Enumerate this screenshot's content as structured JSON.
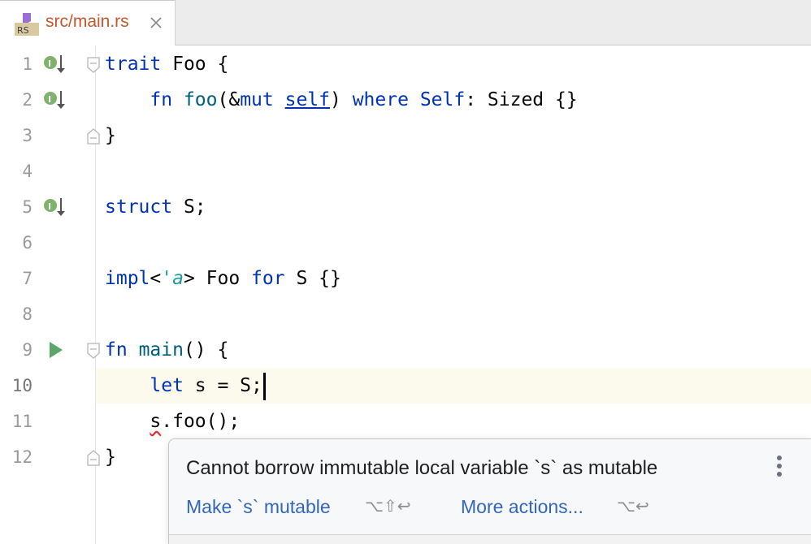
{
  "tab": {
    "label": "src/main.rs",
    "icon": "rust-file-icon",
    "icon_text": "RS"
  },
  "gutter": {
    "line_numbers": [
      "1",
      "2",
      "3",
      "4",
      "5",
      "6",
      "7",
      "8",
      "9",
      "10",
      "11",
      "12"
    ],
    "current_line": "10"
  },
  "code": {
    "l1": {
      "kw": "trait",
      "rest": " Foo {"
    },
    "l2": {
      "indent": "    ",
      "kw1": "fn",
      "sp1": " ",
      "name": "foo",
      "p1": "(&",
      "kw2": "mut",
      "sp2": " ",
      "self": "self",
      "p2": ") ",
      "kw3": "where",
      "sp3": " ",
      "kw4": "Self",
      "rest": ": Sized {}"
    },
    "l3": {
      "text": "}"
    },
    "l5": {
      "kw": "struct",
      "rest": " S;"
    },
    "l7": {
      "kw1": "impl",
      "p1": "<",
      "lt": "'a",
      "p2": "> Foo ",
      "kw2": "for",
      "rest": " S {}"
    },
    "l9": {
      "kw": "fn",
      "sp": " ",
      "name": "main",
      "rest": "() {"
    },
    "l10": {
      "indent": "    ",
      "kw": "let",
      "rest": " s = S;"
    },
    "l11": {
      "indent": "    ",
      "err": "s",
      "rest": ".foo();"
    },
    "l12": {
      "text": "}"
    }
  },
  "popup": {
    "message": "Cannot borrow immutable local variable `s` as mutable",
    "primary_action": "Make `s` mutable",
    "primary_shortcut": "⌥⇧↩",
    "more_actions": "More actions...",
    "more_shortcut": "⌥↩"
  },
  "colors": {
    "keyword": "#0033b3",
    "function": "#00627a",
    "lifetime": "#20999d",
    "link": "#3366bb",
    "tab_label": "#c7562c",
    "error_underline": "#e0332f"
  }
}
